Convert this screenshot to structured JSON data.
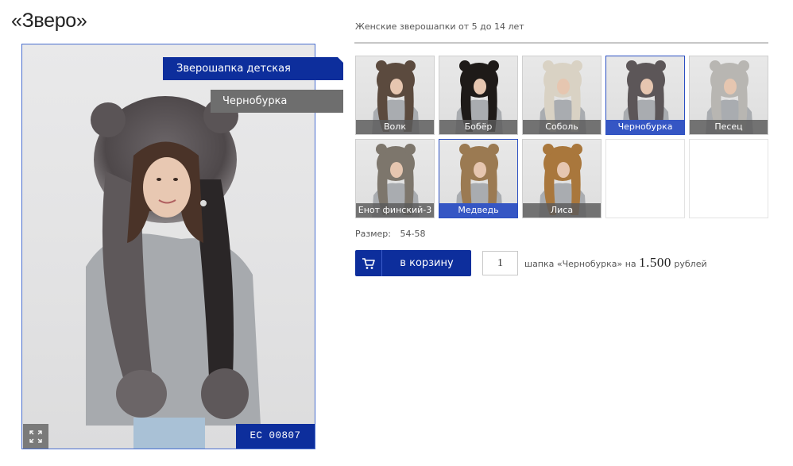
{
  "page": {
    "title": "«Зверо»",
    "subtitle": "Женские зверошапки от 5 до 14 лет"
  },
  "photo": {
    "product_tag": "Зверошапка детская",
    "variant_tag": "Чернобурка",
    "code": "ЕС  00807",
    "zoom_icon": "expand-icon"
  },
  "thumbnails": [
    {
      "label": "Волк",
      "fur": "#5b4a3e",
      "selected": false
    },
    {
      "label": "Бобёр",
      "fur": "#1e1a18",
      "selected": false
    },
    {
      "label": "Соболь",
      "fur": "#d9d2c4",
      "selected": false
    },
    {
      "label": "Чернобурка",
      "fur": "#5c5658",
      "selected": true
    },
    {
      "label": "Песец",
      "fur": "#b8b6b2",
      "selected": false
    },
    {
      "label": "Енот финский-3",
      "fur": "#7d766c",
      "selected": false
    },
    {
      "label": "Медведь",
      "fur": "#9b7a52",
      "selected": true
    },
    {
      "label": "Лиса",
      "fur": "#a9773c",
      "selected": false
    }
  ],
  "empty_slots": 2,
  "size": {
    "label": "Размер:",
    "value": "54-58"
  },
  "cart": {
    "button_label": "в корзину",
    "icon": "cart-icon",
    "quantity": "1",
    "summary_prefix": "шапка «Чернобурка» на",
    "price": "1.500",
    "currency": "рублей"
  },
  "colors": {
    "accent": "#0d2e9c",
    "selected_border": "#2b4fc2",
    "variant_tag": "#6e6e6e"
  }
}
